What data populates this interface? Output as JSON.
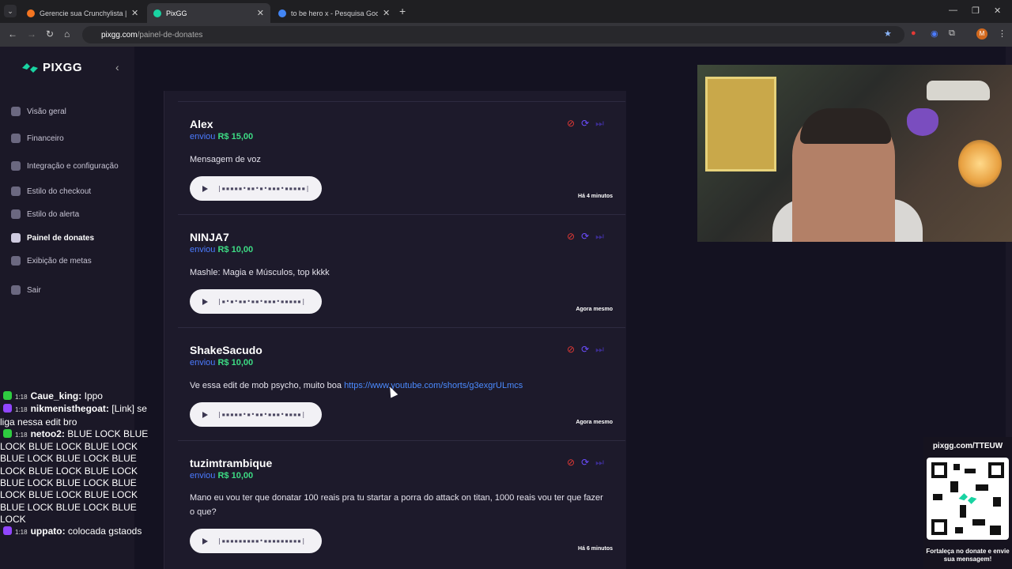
{
  "browser": {
    "tabs": [
      {
        "title": "Gerencie sua Crunchylista | Cru",
        "favicon_color": "#f47521"
      },
      {
        "title": "PixGG",
        "favicon_color": "#19d3a2"
      },
      {
        "title": "to be hero x - Pesquisa Google",
        "favicon_color": "#4285f4"
      }
    ],
    "url_host": "pixgg.com",
    "url_path": "/painel-de-donates",
    "profile_initial": "M"
  },
  "sidebar": {
    "brand": "PIXGG",
    "items": [
      {
        "label": "Visão geral",
        "icon": "home-icon"
      },
      {
        "label": "Financeiro",
        "icon": "wallet-icon"
      },
      {
        "label": "Integração e configuração",
        "icon": "link-icon"
      },
      {
        "label": "Estilo do checkout",
        "icon": "palette-icon"
      },
      {
        "label": "Estilo do alerta",
        "icon": "palette-icon"
      },
      {
        "label": "Painel de donates",
        "icon": "bars-icon"
      },
      {
        "label": "Exibição de metas",
        "icon": "star-icon"
      },
      {
        "label": "Sair",
        "icon": "logout-icon"
      }
    ]
  },
  "donations": [
    {
      "name": "Alex",
      "sent_prefix": "enviou",
      "amount": "R$ 15,00",
      "message": "Mensagem de voz",
      "link": "",
      "ago": "Há 4 minutos"
    },
    {
      "name": "NINJA7",
      "sent_prefix": "enviou",
      "amount": "R$ 10,00",
      "message": "Mashle: Magia e Músculos, top kkkk",
      "link": "",
      "ago": "Agora mesmo"
    },
    {
      "name": "ShakeSacudo",
      "sent_prefix": "enviou",
      "amount": "R$ 10,00",
      "message": "Ve essa edit de mob psycho, muito boa ",
      "link": "https://www.youtube.com/shorts/g3exgrULmcs",
      "ago": "Agora mesmo"
    },
    {
      "name": "tuzimtrambique",
      "sent_prefix": "enviou",
      "amount": "R$ 10,00",
      "message": "Mano eu vou ter que donatar 100 reais pra tu startar a porra do attack on titan, 1000 reais vou ter que fazer o que?",
      "link": "",
      "ago": "Há 6 minutos"
    }
  ],
  "chat": [
    {
      "time": "1:18",
      "user": "Caue_king:",
      "msg": "Ippo",
      "badge_color": "#2ecc40"
    },
    {
      "time": "1:18",
      "user": "nikmenisthegoat:",
      "msg": "[Link] se liga nessa edit bro",
      "badge_color": "#9146ff"
    },
    {
      "time": "1:18",
      "user": "netoo2:",
      "msg": "BLUE LOCK BLUE LOCK BLUE LOCK BLUE LOCK BLUE LOCK BLUE LOCK BLUE LOCK BLUE LOCK BLUE LOCK BLUE LOCK BLUE LOCK BLUE LOCK BLUE LOCK BLUE LOCK BLUE LOCK BLUE LOCK BLUE LOCK",
      "badge_color": "#2ecc40"
    },
    {
      "time": "1:18",
      "user": "uppato:",
      "msg": "colocada gstaods",
      "badge_color": "#9146ff"
    }
  ],
  "qr_widget": {
    "url": "pixgg.com/TTEUW",
    "caption": "Fortaleça no donate e envie sua mensagem!"
  }
}
